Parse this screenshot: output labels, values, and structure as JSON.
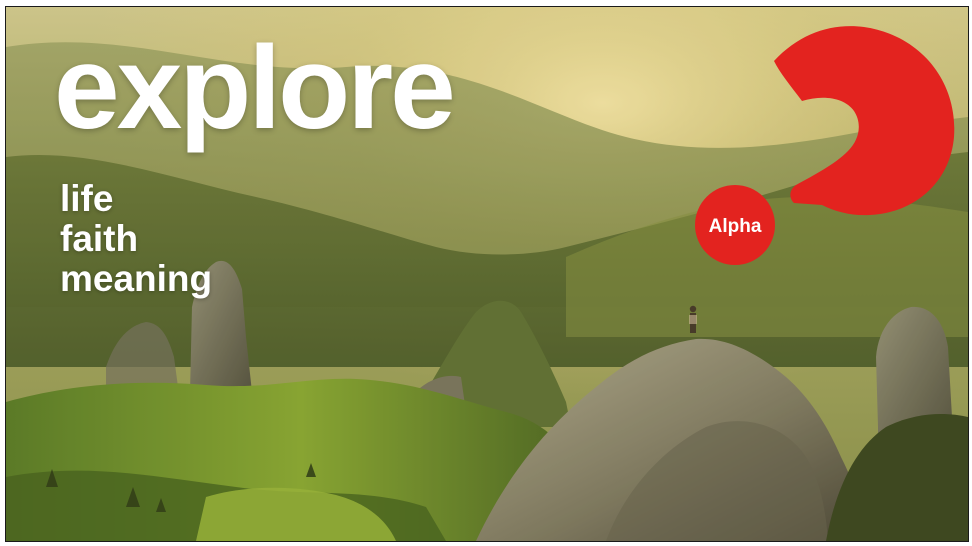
{
  "headline": "explore",
  "taglines": [
    "life",
    "faith",
    "meaning"
  ],
  "logo": {
    "text": "Alpha",
    "color": "#e3231f",
    "text_color": "#ffffff"
  },
  "colors": {
    "text": "#ffffff",
    "logo_red": "#e3231f"
  }
}
